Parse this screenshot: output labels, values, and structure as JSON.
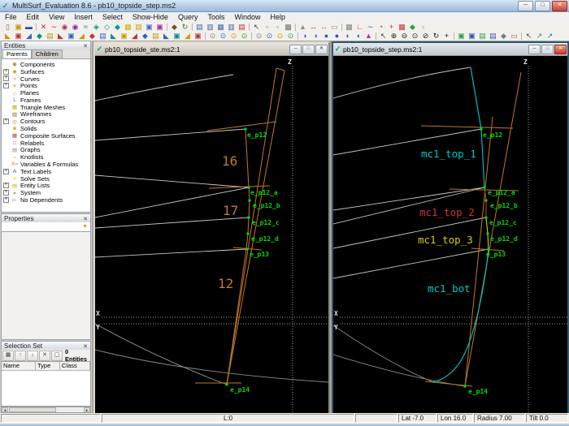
{
  "window": {
    "title": "MultiSurf_Evaluation 8.6 - pb10_topside_step.ms2",
    "menus": [
      "File",
      "Edit",
      "View",
      "Insert",
      "Select",
      "Show-Hide",
      "Query",
      "Tools",
      "Window",
      "Help"
    ]
  },
  "icons": {
    "app_logo": "✓",
    "minimize": "─",
    "maximize": "□",
    "close": "✕",
    "panel_close": "✕",
    "filter": "▼",
    "scroll_left": "◂",
    "scroll_right": "▸"
  },
  "toolbar1": [
    {
      "n": "new-file-icon",
      "g": "▯",
      "c": "#707070"
    },
    {
      "n": "open-file-icon",
      "g": "▣",
      "c": "#c8960a"
    },
    {
      "n": "save-icon",
      "g": "▬",
      "c": "#2850a0"
    },
    {
      "sep": true
    },
    {
      "n": "point-tool-icon",
      "g": "✕",
      "c": "#c03030"
    },
    {
      "n": "curve-tool-icon",
      "g": "∼",
      "c": "#c03030"
    },
    {
      "n": "bead-tool-icon",
      "g": "◉",
      "c": "#b03060"
    },
    {
      "n": "magnet-tool-icon",
      "g": "◉",
      "c": "#7030a0"
    },
    {
      "n": "snake-tool-icon",
      "g": "≈",
      "c": "#3060c0"
    },
    {
      "n": "surface-tool-icon",
      "g": "◈",
      "c": "#0098a0"
    },
    {
      "n": "surface-tool-icon",
      "g": "◇",
      "c": "#0098a0"
    },
    {
      "n": "surface-tool-icon",
      "g": "◆",
      "c": "#0098a0"
    },
    {
      "n": "mesh-tool-icon",
      "g": "▦",
      "c": "#c8b400"
    },
    {
      "n": "entity-tool-icon",
      "g": "▤",
      "c": "#c8a000"
    },
    {
      "n": "entity-tool-icon",
      "g": "▣",
      "c": "#4868c0"
    },
    {
      "n": "entity-tool-icon",
      "g": "▣",
      "c": "#a030a0"
    },
    {
      "sep": true
    },
    {
      "n": "entity-tool-icon",
      "g": "◆",
      "c": "#605820"
    },
    {
      "n": "undo-icon",
      "g": "↻",
      "c": "#308030"
    },
    {
      "sep": true
    },
    {
      "n": "window-layout-icon",
      "g": "▤",
      "c": "#3868b0"
    },
    {
      "n": "window-layout-icon",
      "g": "▥",
      "c": "#3868b0"
    },
    {
      "n": "window-layout-icon",
      "g": "▦",
      "c": "#3868b0"
    },
    {
      "n": "window-layout-icon",
      "g": "▥",
      "c": "#3868b0"
    },
    {
      "n": "window-layout-icon",
      "g": "▤",
      "c": "#c03030"
    },
    {
      "sep": true
    },
    {
      "n": "select-pointer-icon",
      "g": "↖",
      "c": "#404040"
    },
    {
      "n": "select-fence-icon",
      "g": "▫",
      "c": "#808080"
    },
    {
      "n": "select-fence-icon",
      "g": "▫",
      "c": "#808080"
    },
    {
      "n": "select-all-icon",
      "g": "▩",
      "c": "#707070"
    },
    {
      "sep": true
    },
    {
      "n": "measure-icon",
      "g": "▲",
      "c": "#909090"
    },
    {
      "n": "arrows-icon",
      "g": "↔",
      "c": "#c03030"
    },
    {
      "n": "arrows-icon",
      "g": "↔",
      "c": "#c06030"
    },
    {
      "n": "frame-icon",
      "g": "▭",
      "c": "#909090"
    },
    {
      "sep": true
    },
    {
      "n": "grid-icon",
      "g": "▦",
      "c": "#808080"
    },
    {
      "n": "angle-icon",
      "g": "∟",
      "c": "#c03030"
    },
    {
      "n": "curvature-icon",
      "g": "∼",
      "c": "#3060c0"
    },
    {
      "n": "gauge-icon",
      "g": "◔",
      "c": "#c03030"
    },
    {
      "n": "crosshair-icon",
      "g": "+",
      "c": "#c03030"
    },
    {
      "n": "grid-icon",
      "g": "▦",
      "c": "#c03030"
    },
    {
      "n": "diamond-icon",
      "g": "◆",
      "c": "#30a030"
    },
    {
      "n": "frame-icon",
      "g": "▫",
      "c": "#808080"
    }
  ],
  "toolbar2": [
    {
      "n": "entity-edit-icon",
      "g": "◣",
      "c": "#c0a000"
    },
    {
      "n": "entity-edit-icon",
      "g": "▣",
      "c": "#c03030"
    },
    {
      "n": "entity-edit-icon",
      "g": "◢",
      "c": "#3060c0"
    },
    {
      "n": "entity-edit-icon",
      "g": "◆",
      "c": "#009090"
    },
    {
      "n": "entity-edit-icon",
      "g": "▤",
      "c": "#c0a000"
    },
    {
      "n": "entity-edit-icon",
      "g": "◣",
      "c": "#c03030"
    },
    {
      "n": "entity-edit-icon",
      "g": "▣",
      "c": "#3060c0"
    },
    {
      "n": "entity-edit-icon",
      "g": "◢",
      "c": "#c0a000"
    },
    {
      "n": "entity-edit-icon",
      "g": "◆",
      "c": "#c03030"
    },
    {
      "n": "entity-edit-icon",
      "g": "▤",
      "c": "#3060c0"
    },
    {
      "n": "entity-edit-icon",
      "g": "◣",
      "c": "#009090"
    },
    {
      "n": "entity-edit-icon",
      "g": "▣",
      "c": "#c0a000"
    },
    {
      "n": "entity-edit-icon",
      "g": "◢",
      "c": "#c03030"
    },
    {
      "n": "entity-edit-icon",
      "g": "◆",
      "c": "#3060c0"
    },
    {
      "n": "entity-edit-icon",
      "g": "▤",
      "c": "#c0a000"
    },
    {
      "n": "entity-edit-icon",
      "g": "◣",
      "c": "#3060c0"
    },
    {
      "n": "entity-edit-icon",
      "g": "▣",
      "c": "#009090"
    },
    {
      "n": "entity-edit-icon",
      "g": "◢",
      "c": "#c0a000"
    },
    {
      "n": "entity-edit-icon",
      "g": "▣",
      "c": "#c03030"
    },
    {
      "sep": true
    },
    {
      "n": "visibility-icon",
      "g": "⊙",
      "c": "#808080"
    },
    {
      "n": "visibility-icon",
      "g": "⊙",
      "c": "#3060c0"
    },
    {
      "n": "visibility-icon",
      "g": "⊙",
      "c": "#c0a000"
    },
    {
      "n": "visibility-icon",
      "g": "⊙",
      "c": "#30a030"
    },
    {
      "sep": true
    },
    {
      "n": "visibility-icon",
      "g": "⊙",
      "c": "#808080"
    },
    {
      "n": "visibility-icon",
      "g": "⊙",
      "c": "#3060c0"
    },
    {
      "n": "visibility-icon",
      "g": "⊙",
      "c": "#c0a000"
    },
    {
      "n": "visibility-icon",
      "g": "⊙",
      "c": "#30a030"
    },
    {
      "sep": true
    },
    {
      "n": "view-preset-icon",
      "g": "◗",
      "c": "#2858b0"
    },
    {
      "n": "view-preset-icon",
      "g": "◖",
      "c": "#2858b0"
    },
    {
      "n": "view-preset-icon",
      "g": "●",
      "c": "#2858b0"
    },
    {
      "n": "view-preset-icon",
      "g": "●",
      "c": "#2858b0"
    },
    {
      "n": "view-preset-icon",
      "g": "◗",
      "c": "#2858b0"
    },
    {
      "n": "view-preset-icon",
      "g": "◖",
      "c": "#2858b0"
    },
    {
      "n": "view-rotate-icon",
      "g": "▲",
      "c": "#b030b0"
    },
    {
      "sep": true
    },
    {
      "n": "zoom-box-icon",
      "g": "↖",
      "c": "#404040"
    },
    {
      "n": "zoom-in-icon",
      "g": "⊕",
      "c": "#202020"
    },
    {
      "n": "zoom-out-icon",
      "g": "⊖",
      "c": "#202020"
    },
    {
      "n": "zoom-fit-icon",
      "g": "⊙",
      "c": "#202020"
    },
    {
      "n": "zoom-prev-icon",
      "g": "⊘",
      "c": "#202020"
    },
    {
      "n": "rotate-view-icon",
      "g": "↻",
      "c": "#202020"
    },
    {
      "n": "pan-icon",
      "g": "+",
      "c": "#202020"
    },
    {
      "sep": true
    },
    {
      "n": "display-mode-icon",
      "g": "▣",
      "c": "#30a050"
    },
    {
      "n": "display-mode-icon",
      "g": "▣",
      "c": "#2858b0"
    },
    {
      "n": "display-mode-icon",
      "g": "▤",
      "c": "#30a050"
    },
    {
      "n": "display-mode-icon",
      "g": "▤",
      "c": "#2858b0"
    },
    {
      "n": "display-mode-icon",
      "g": "◆",
      "c": "#708070"
    },
    {
      "n": "display-mode-icon",
      "g": "▭",
      "c": "#c05050"
    },
    {
      "sep": true
    },
    {
      "n": "pick-icon",
      "g": "↖",
      "c": "#404040"
    },
    {
      "n": "pick-icon",
      "g": "↗",
      "c": "#30a030"
    },
    {
      "n": "pick-icon",
      "g": "↗",
      "c": "#009090"
    }
  ],
  "entities": {
    "title": "Entities",
    "tabs": [
      "Parents",
      "Children"
    ],
    "items": [
      {
        "n": "tree-item-components",
        "box": "",
        "g": "◉",
        "c": "#b08820",
        "label": "Components"
      },
      {
        "n": "tree-item-surfaces",
        "box": "+",
        "g": "◆",
        "c": "#c0a818",
        "label": "Surfaces"
      },
      {
        "n": "tree-item-curves",
        "box": "+",
        "g": "∼",
        "c": "#c04040",
        "label": "Curves"
      },
      {
        "n": "tree-item-points",
        "box": "+",
        "g": "✕",
        "c": "#c8b400",
        "label": "Points"
      },
      {
        "n": "tree-item-planes",
        "box": "",
        "g": "◇",
        "c": "#a0a0a0",
        "label": "Planes"
      },
      {
        "n": "tree-item-frames",
        "box": "",
        "g": "L",
        "c": "#4868b8",
        "label": "Frames"
      },
      {
        "n": "tree-item-triangle-meshes",
        "box": "",
        "g": "▦",
        "c": "#c8b400",
        "label": "Triangle Meshes"
      },
      {
        "n": "tree-item-wireframes",
        "box": "",
        "g": "▨",
        "c": "#807020",
        "label": "Wireframes"
      },
      {
        "n": "tree-item-contours",
        "box": "+",
        "g": "◎",
        "c": "#c87820",
        "label": "Contours"
      },
      {
        "n": "tree-item-solids",
        "box": "",
        "g": "■",
        "c": "#c8b400",
        "label": "Solids"
      },
      {
        "n": "tree-item-composite-surfaces",
        "box": "",
        "g": "▦",
        "c": "#c04040",
        "label": "Composite Surfaces"
      },
      {
        "n": "tree-item-relabels",
        "box": "",
        "g": "□",
        "c": "#c04040",
        "label": "Relabels"
      },
      {
        "n": "tree-item-graphs",
        "box": "",
        "g": "▤",
        "c": "#888888",
        "label": "Graphs"
      },
      {
        "n": "tree-item-knotlists",
        "box": "",
        "g": "∼",
        "c": "#c8a000",
        "label": "Knotlists"
      },
      {
        "n": "tree-item-variables-formulas",
        "box": "",
        "g": "X=",
        "c": "#b09000",
        "label": "Variables & Formulas"
      },
      {
        "n": "tree-item-text-labels",
        "box": "+",
        "g": "A",
        "c": "#3838b0",
        "label": "Text Labels"
      },
      {
        "n": "tree-item-solve-sets",
        "box": "",
        "g": "=",
        "c": "#c8b400",
        "label": "Solve Sets"
      },
      {
        "n": "tree-item-entity-lists",
        "box": "+",
        "g": "▤",
        "c": "#c8b400",
        "label": "Entity Lists"
      },
      {
        "n": "tree-item-system",
        "box": "+",
        "g": "∗",
        "c": "#b8a000",
        "label": "System"
      },
      {
        "n": "tree-item-no-dependents",
        "box": "+",
        "g": "⊢",
        "c": "#4868b8",
        "label": "No Dependents"
      }
    ]
  },
  "properties": {
    "title": "Properties"
  },
  "selection_set": {
    "title": "Selection Set",
    "buttons": [
      {
        "n": "add-entities-button",
        "g": "▦"
      },
      {
        "n": "move-up-button",
        "g": "↑"
      },
      {
        "n": "move-down-button",
        "g": "↓"
      },
      {
        "n": "remove-button",
        "g": "✕"
      },
      {
        "n": "clear-button",
        "g": "▢"
      }
    ],
    "count": "0 Entities",
    "columns": [
      "Name",
      "Type",
      "Class"
    ]
  },
  "viewports": {
    "vp1_title": "pb10_topside_ste.ms2:1",
    "vp2_title": "pb10_topside_step.ms2:1"
  },
  "labels": {
    "z": "Z",
    "x": "X",
    "y": "Y",
    "n16": "16",
    "n17": "17",
    "n12": "12",
    "p12": "e_p12",
    "p12a": "e_p12_a",
    "p12b": "e_p12_b",
    "p12c": "e_p12_c",
    "p12d": "e_p12_d",
    "p13": "e_p13",
    "p14": "e_p14",
    "mt1": "mc1_top_1",
    "mt2": "mc1_top_2",
    "mt3": "mc1_top_3",
    "mb": "mc1_bot"
  },
  "statusbar": {
    "l0": "L:0",
    "lat": "Lat -7.0",
    "lon": "Lon 16.0",
    "radius": "Radius 7.00",
    "tilt": "Tilt 0.0"
  },
  "colors": {
    "orange": "#c87a26",
    "green": "#00dd00",
    "cyan": "#00c8c8",
    "crimson": "#cc3340",
    "yellow": "#d0d000",
    "canvas": "#000000"
  }
}
